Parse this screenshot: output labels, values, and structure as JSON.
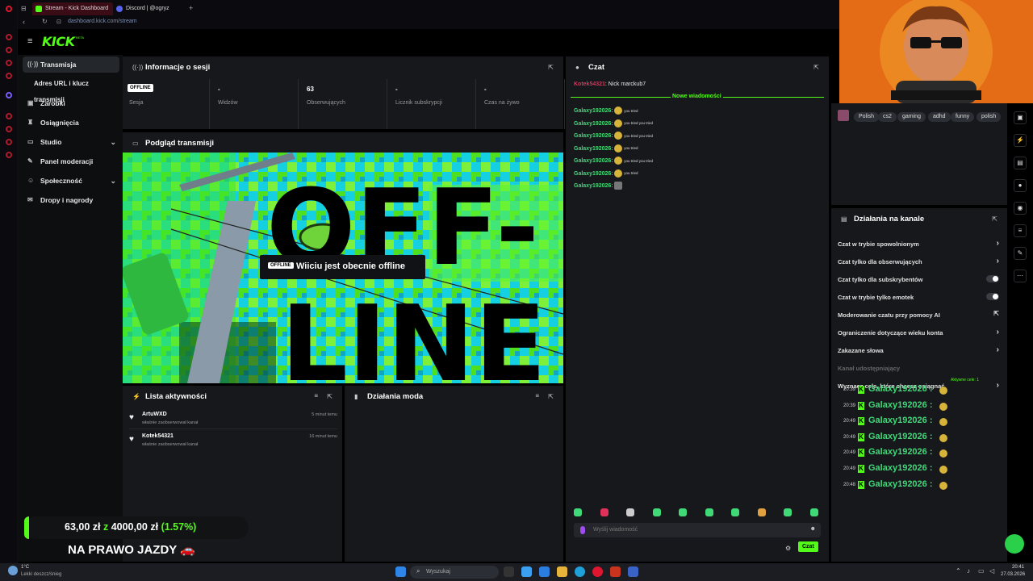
{
  "browser": {
    "tabs": [
      {
        "label": "Stream - Kick Dashboard",
        "color": "#53fc18"
      },
      {
        "label": "Discord | @ogryz",
        "color": "#5865f2"
      }
    ],
    "url": "dashboard.kick.com/stream"
  },
  "kick": {
    "logo": "KICK",
    "logo_beta": "BETA"
  },
  "sidebar": {
    "items": [
      {
        "label": "Transmisja",
        "icon": "broadcast-icon",
        "glyph": "((·))",
        "active": true
      },
      {
        "label": "Adres URL i klucz transmisji",
        "icon": "",
        "glyph": ""
      },
      {
        "label": "Zarobki",
        "icon": "wallet-icon",
        "glyph": "▣"
      },
      {
        "label": "Osiągnięcia",
        "icon": "trophy-icon",
        "glyph": "♜"
      },
      {
        "label": "Studio",
        "icon": "camera-icon",
        "glyph": "▭",
        "chevron": "⌄"
      },
      {
        "label": "Panel moderacji",
        "icon": "sword-icon",
        "glyph": "✎"
      },
      {
        "label": "Społeczność",
        "icon": "users-icon",
        "glyph": "☺",
        "chevron": "⌄"
      },
      {
        "label": "Dropy i nagrody",
        "icon": "gift-icon",
        "glyph": "✉"
      }
    ]
  },
  "session": {
    "title": "Informacje o sesji",
    "offline_badge": "OFFLINE",
    "stats": [
      {
        "value": "",
        "label": "Sesja"
      },
      {
        "value": "-",
        "label": "Widzów"
      },
      {
        "value": "63",
        "label": "Obserwujących"
      },
      {
        "value": "-",
        "label": "Licznik subskrypcji"
      },
      {
        "value": "-",
        "label": "Czas na żywo"
      }
    ]
  },
  "preview": {
    "title": "Podgląd transmisji",
    "overlay_badge": "OFFLINE",
    "overlay_text": "Wiiciu jest obecnie offline",
    "big_text_1": "OFF-",
    "big_text_2": "LINE"
  },
  "activity": {
    "title": "Lista aktywności",
    "items": [
      {
        "user": "ArtuWXD",
        "desc": "właśnie zaobserwował kanał",
        "time": "5 minut temu"
      },
      {
        "user": "Kotek54321",
        "desc": "właśnie zaobserwował kanał",
        "time": "16 minut temu"
      }
    ]
  },
  "mod": {
    "title": "Działania moda"
  },
  "chat": {
    "title": "Czat",
    "first_line_user": "Kotek54321",
    "first_line_text": ": Nick marckub7",
    "new_messages": "Nowe wiadomości",
    "messages": [
      {
        "user": "Galaxy192026",
        "emote_text": "you tried"
      },
      {
        "user": "Galaxy192026",
        "emote_text": "you tried you tried"
      },
      {
        "user": "Galaxy192026",
        "emote_text": "you tried you tried"
      },
      {
        "user": "Galaxy192026",
        "emote_text": "you tried"
      },
      {
        "user": "Galaxy192026",
        "emote_text": "you tried you tried"
      },
      {
        "user": "Galaxy192026",
        "emote_text": "you tried"
      },
      {
        "user": "Galaxy192026",
        "emote_text": ""
      }
    ],
    "input_placeholder": "Wyślij wiadomość",
    "send_label": "Czat"
  },
  "channel": {
    "tags": [
      "Polish",
      "cs2",
      "gaming",
      "adhd",
      "funny",
      "polish"
    ],
    "actions_title": "Działania na kanale",
    "settings": [
      {
        "label": "Czat w trybie spowolnionym",
        "control": "chevron"
      },
      {
        "label": "Czat tylko dla obserwujących",
        "control": "chevron"
      },
      {
        "label": "Czat tylko dla subskrybentów",
        "control": "toggle"
      },
      {
        "label": "Czat w trybie tylko emotek",
        "control": "toggle"
      },
      {
        "label": "Moderowanie czatu przy pomocy AI",
        "control": "popout"
      },
      {
        "label": "Ograniczenie dotyczące wieku konta",
        "control": "chevron"
      },
      {
        "label": "Zakazane słowa",
        "control": "chevron"
      },
      {
        "label": "Kanał udostępniający",
        "control": "none"
      },
      {
        "label": "Wyznacz cele, które chcesz osiągnąć",
        "control": "chevron"
      }
    ],
    "goal_status": "Aktywne cele: 1"
  },
  "overlay": {
    "chat_lines": [
      {
        "time": "20:39",
        "user": "Galaxy192026 :"
      },
      {
        "time": "20:39",
        "user": "Galaxy192026 :"
      },
      {
        "time": "20:49",
        "user": "Galaxy192026 :"
      },
      {
        "time": "20:49",
        "user": "Galaxy192026 :"
      },
      {
        "time": "20:49",
        "user": "Galaxy192026 :"
      },
      {
        "time": "20:49",
        "user": "Galaxy192026 :"
      },
      {
        "time": "20:48",
        "user": "Galaxy192026 :"
      }
    ],
    "goal_current": "63,00 zł",
    "goal_sep": "z",
    "goal_target": "4000,00 zł",
    "goal_percent": "(1.57%)",
    "goal_progress": 0.0157,
    "goal_title": "NA PRAWO JAZDY 🚗"
  },
  "taskbar": {
    "weather_temp": "1°C",
    "weather_desc": "Lekki deszcz/śnieg",
    "search_placeholder": "Wyszukaj",
    "time": "20:41",
    "date": "27.03.2026"
  }
}
